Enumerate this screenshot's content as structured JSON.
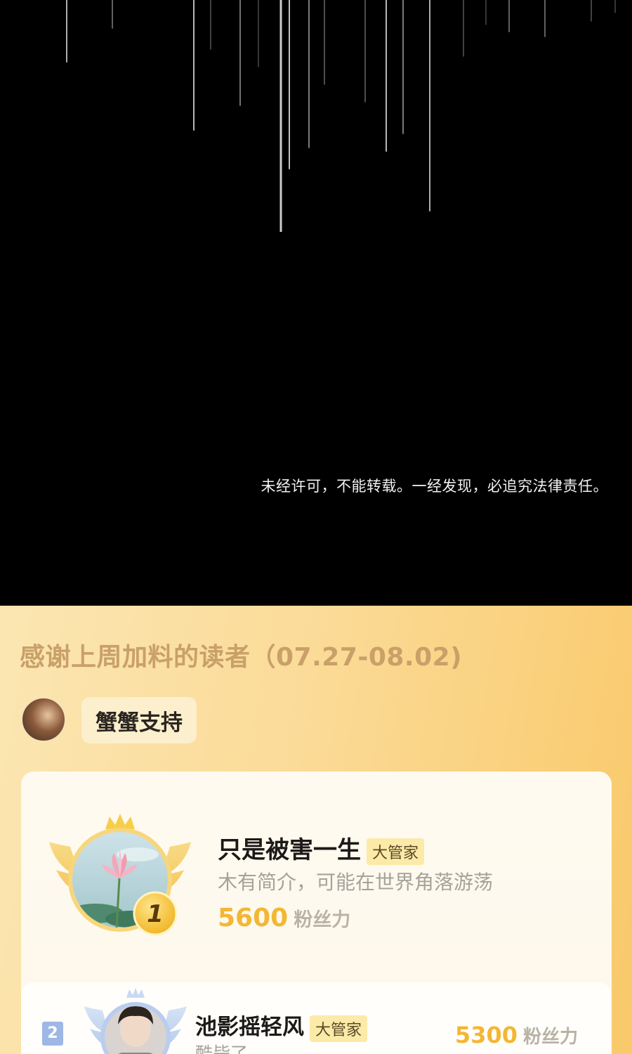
{
  "comic": {
    "copyright_notice": "未经许可，不能转载。一经发现，必追究法律责任。"
  },
  "supporters": {
    "title": "感谢上周加料的读者（07.27-08.02)",
    "author_bubble": "蟹蟹支持",
    "top_fans": [
      {
        "rank": "1",
        "name": "只是被害一生",
        "tag": "大管家",
        "bio": "木有简介，可能在世界角落游荡",
        "power_value": "5600",
        "power_unit": "粉丝力"
      },
      {
        "rank": "2",
        "name": "池影摇轻风",
        "tag": "大管家",
        "bio": "酷毙了",
        "power_value": "5300",
        "power_unit": "粉丝力"
      }
    ]
  },
  "colors": {
    "title": "#c9a069",
    "gold": "#f3b735",
    "tag_bg": "#fbeaa8",
    "rank2_blue": "#9eb7e4"
  },
  "icons": [
    "crown-icon",
    "laurel-wings-icon",
    "rank-1-medal-icon",
    "rank-2-medal-icon"
  ]
}
